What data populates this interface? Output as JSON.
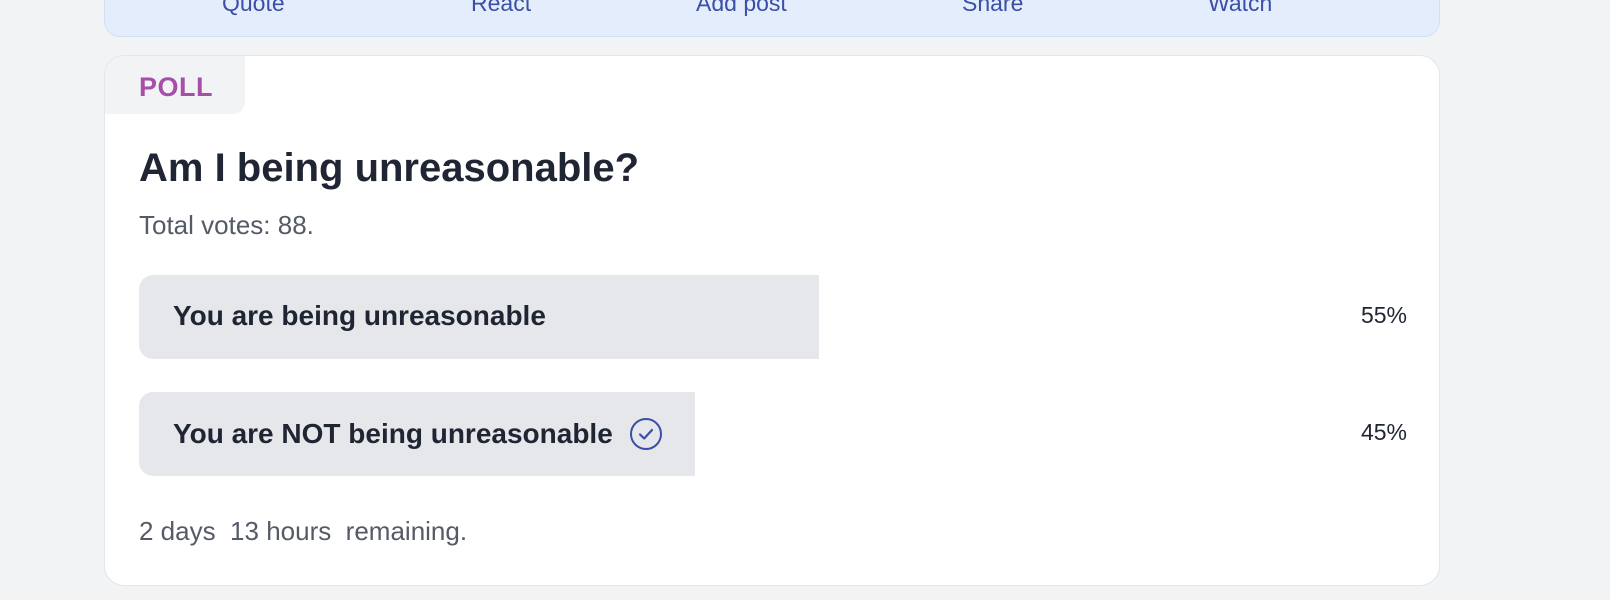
{
  "action_bar": {
    "items": [
      {
        "label": "Quote"
      },
      {
        "label": "React"
      },
      {
        "label": "Add post"
      },
      {
        "label": "Share"
      },
      {
        "label": "Watch"
      }
    ]
  },
  "poll": {
    "tag": "POLL",
    "question": "Am I being unreasonable?",
    "total_votes_text": "Total votes: 88.",
    "options": [
      {
        "label": "You are being unreasonable",
        "percent_text": "55%",
        "percent": 55,
        "selected": false
      },
      {
        "label": "You are NOT being unreasonable",
        "percent_text": "45%",
        "percent": 45,
        "selected": true
      }
    ],
    "remaining_text": "2 days  13 hours  remaining."
  },
  "colors": {
    "tag": "#a64ea8",
    "accent": "#3b4fa6",
    "bar_fill": "#e5e7ea"
  },
  "icons": {
    "selected_option": "check-circle-icon"
  }
}
